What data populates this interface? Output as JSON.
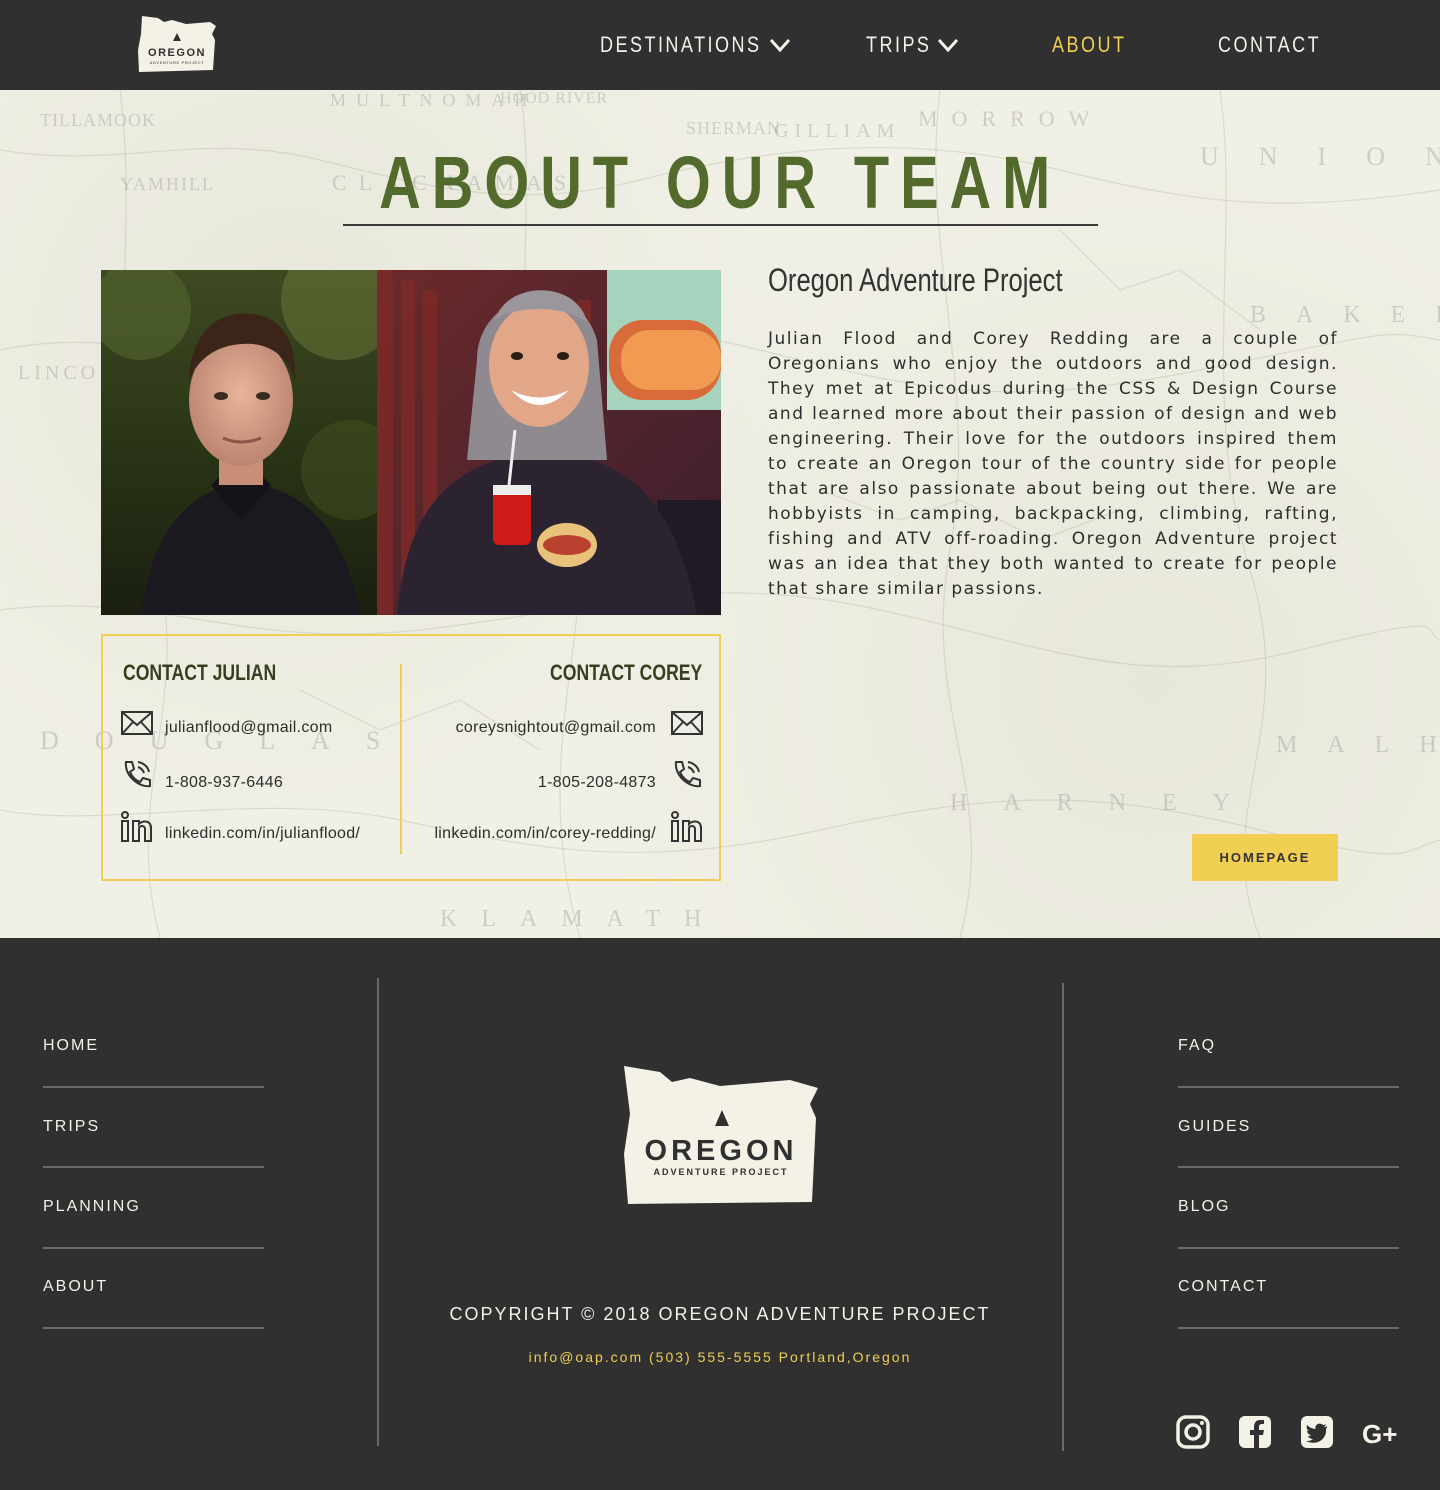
{
  "header": {
    "logo": {
      "line1": "OREGON",
      "line2": "ADVENTURE PROJECT",
      "icon": "oregon-state-logo"
    },
    "nav": {
      "destinations": "DESTINATIONS",
      "trips": "TRIPS",
      "about": "ABOUT",
      "contact": "CONTACT"
    },
    "active_color": "#f0cf52"
  },
  "main": {
    "title": "ABOUT OUR TEAM",
    "photos": {
      "julian": "julian-portrait",
      "corey": "corey-portrait"
    },
    "contact_julian": {
      "heading": "CONTACT JULIAN",
      "email": "julianflood@gmail.com",
      "phone": "1-808-937-6446",
      "linkedin": "linkedin.com/in/julianflood/"
    },
    "contact_corey": {
      "heading": "CONTACT COREY",
      "email": "coreysnightout@gmail.com",
      "phone": "1-805-208-4873",
      "linkedin": "linkedin.com/in/corey-redding/"
    },
    "org_heading": "Oregon Adventure Project",
    "about_text": "Julian Flood and Corey Redding are a couple of Oregonians who enjoy the outdoors and good design. They met at Epicodus during the CSS & Design Course and learned more about their passion of design and web engineering. Their love for the outdoors inspired them to create an Oregon tour of the country side for people that are also passionate about being out there. We are hobbyists in camping, backpacking, climbing, rafting, fishing and ATV off-roading. Oregon Adventure project was an idea that they both wanted to create for people that share similar passions.",
    "homepage_button": "HOMEPAGE",
    "map_labels": [
      "TILLAMOOK",
      "MULTNOMAH",
      "HOOD RIVER",
      "SHERMAN",
      "GILLIAM",
      "MORROW",
      "UNION",
      "YAMHILL",
      "CLACKAMAS",
      "BAKER",
      "LINCOLN",
      "DOUGLAS",
      "HARNEY",
      "MALHEUR",
      "KLAMATH"
    ]
  },
  "footer": {
    "left_links": [
      "HOME",
      "TRIPS",
      "PLANNING",
      "ABOUT"
    ],
    "right_links": [
      "FAQ",
      "GUIDES",
      "BLOG",
      "CONTACT"
    ],
    "logo": {
      "line1": "OREGON",
      "line2": "ADVENTURE PROJECT"
    },
    "copyright": "COPYRIGHT © 2018 OREGON ADVENTURE PROJECT",
    "info": "info@oap.com (503) 555-5555 Portland,Oregon",
    "social": [
      "instagram-icon",
      "facebook-icon",
      "twitter-icon",
      "google-plus-icon"
    ],
    "social_labels": {
      "google_plus": "G+"
    }
  },
  "colors": {
    "dark": "#303030",
    "accent": "#f0cf52",
    "title_green": "#526a2c",
    "paper": "#f1f0e6"
  }
}
